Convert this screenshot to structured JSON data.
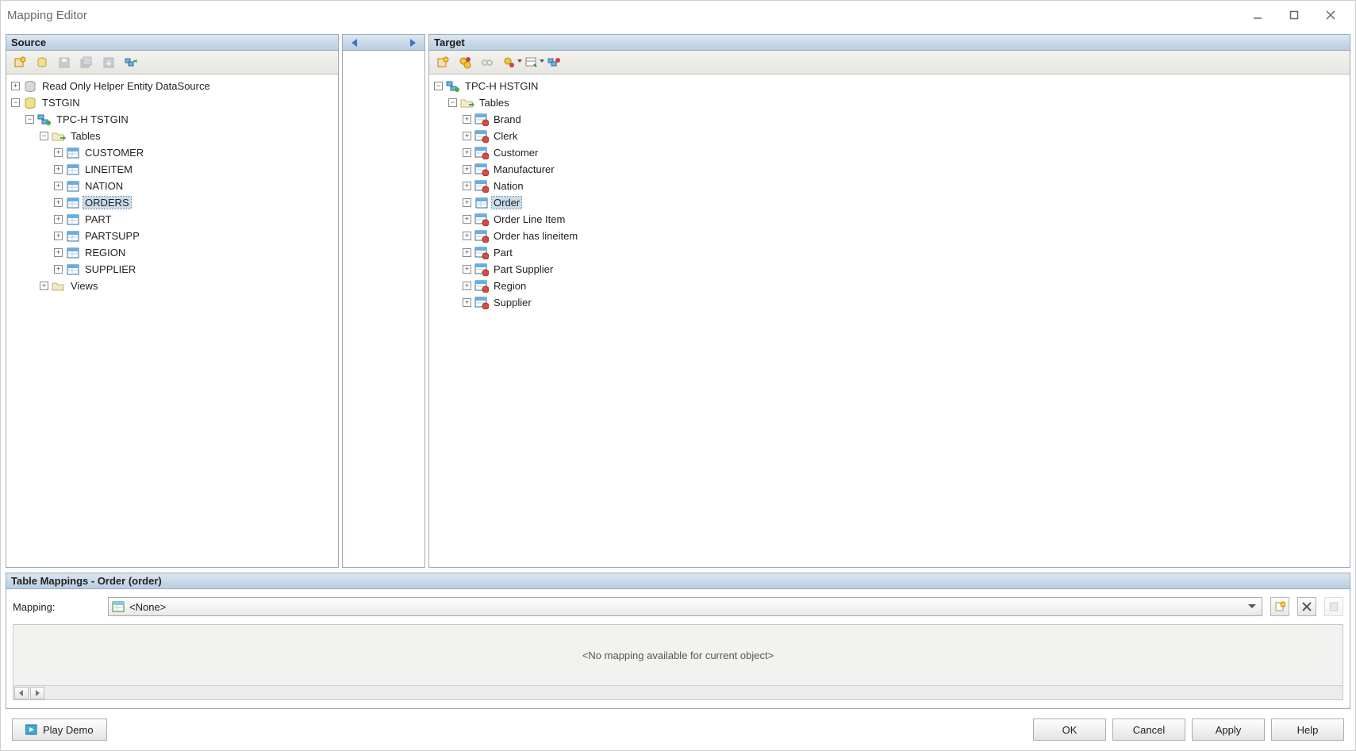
{
  "window": {
    "title": "Mapping Editor"
  },
  "source": {
    "header": "Source",
    "tree": {
      "root1": {
        "label": "Read Only Helper Entity DataSource"
      },
      "root2": {
        "label": "TSTGIN"
      },
      "schema": {
        "label": "TPC-H TSTGIN"
      },
      "tables_label": "Tables",
      "tables": [
        "CUSTOMER",
        "LINEITEM",
        "NATION",
        "ORDERS",
        "PART",
        "PARTSUPP",
        "REGION",
        "SUPPLIER"
      ],
      "selected": "ORDERS",
      "views_label": "Views"
    }
  },
  "target": {
    "header": "Target",
    "tree": {
      "schema": {
        "label": "TPC-H HSTGIN"
      },
      "tables_label": "Tables",
      "tables": [
        "Brand",
        "Clerk",
        "Customer",
        "Manufacturer",
        "Nation",
        "Order",
        "Order Line Item",
        "Order has lineitem",
        "Part",
        "Part Supplier",
        "Region",
        "Supplier"
      ],
      "selected": "Order"
    }
  },
  "mappings": {
    "header": "Table Mappings - Order (order)",
    "label": "Mapping:",
    "combo_value": "<None>",
    "empty_msg": "<No mapping available for current object>"
  },
  "footer": {
    "play_demo": "Play Demo",
    "ok": "OK",
    "cancel": "Cancel",
    "apply": "Apply",
    "help": "Help"
  }
}
